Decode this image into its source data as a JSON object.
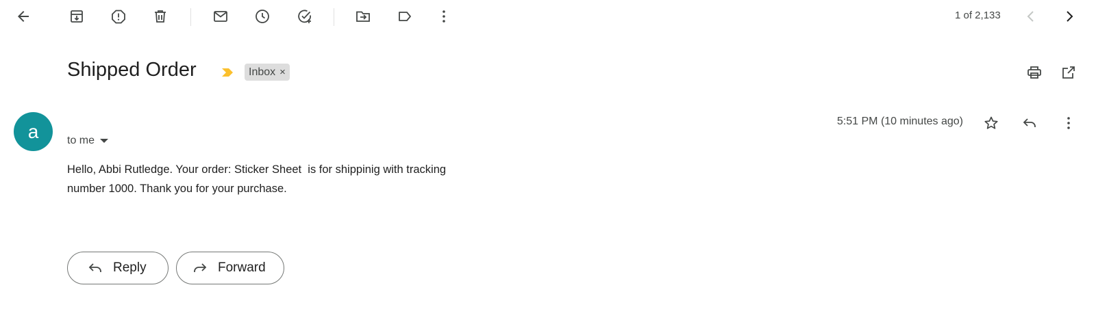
{
  "toolbar": {
    "back_icon": "arrow-left-icon",
    "archive_icon": "archive-icon",
    "spam_icon": "report-spam-icon",
    "delete_icon": "trash-icon",
    "unread_icon": "mail-icon",
    "snooze_icon": "clock-icon",
    "task_icon": "add-task-icon",
    "move_icon": "move-to-icon",
    "label_icon": "label-icon",
    "more_icon": "more-vertical-icon",
    "pagination": "1 of 2,133",
    "prev_icon": "chevron-left-icon",
    "next_icon": "chevron-right-icon"
  },
  "message": {
    "subject": "Shipped Order",
    "importance_color": "#fbc02d",
    "label": "Inbox",
    "label_remove": "×",
    "sender_initial": "a",
    "avatar_color": "#12939a",
    "recipient": "to me",
    "timestamp": "5:51 PM (10 minutes ago)",
    "body": "Hello, Abbi Rutledge. Your order: Sticker Sheet  is for shippinig with tracking number 1000. Thank you for your purchase."
  },
  "actions": {
    "reply_label": "Reply",
    "forward_label": "Forward"
  }
}
